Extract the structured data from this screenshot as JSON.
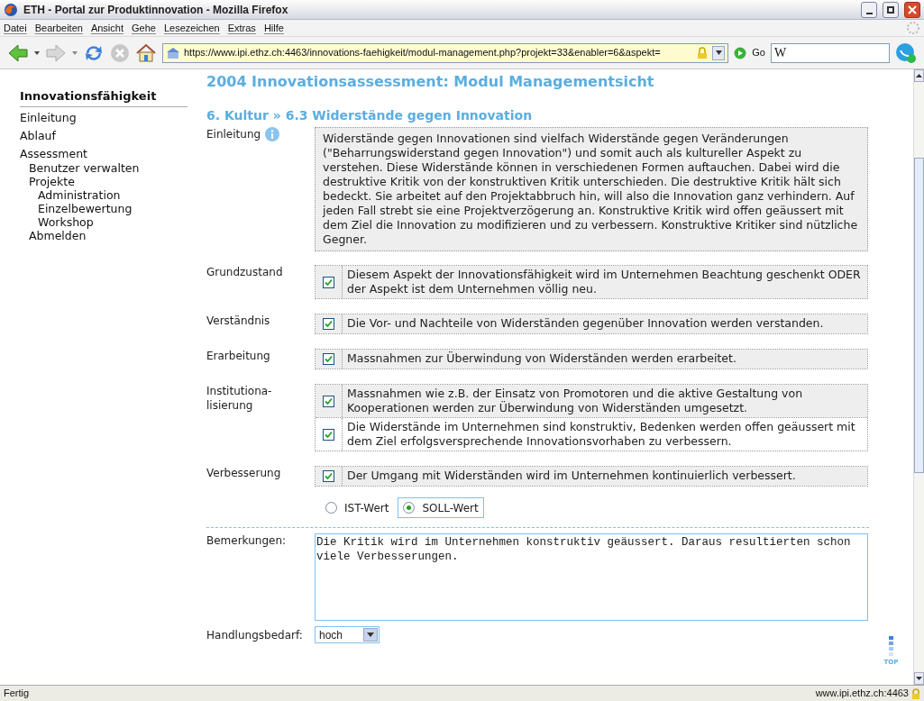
{
  "window": {
    "title": "ETH - Portal zur Produktinnovation - Mozilla Firefox"
  },
  "menu": [
    "Datei",
    "Bearbeiten",
    "Ansicht",
    "Gehe",
    "Lesezeichen",
    "Extras",
    "Hilfe"
  ],
  "toolbar": {
    "address": "https://www.ipi.ethz.ch:4463/innovations-faehigkeit/modul-management.php?projekt=33&enabler=6&aspekt=",
    "go": "Go",
    "search_logo": "W"
  },
  "sidebar": {
    "heading": "Innovationsfähigkeit",
    "items": [
      {
        "label": "Einleitung"
      },
      {
        "label": "Ablauf"
      },
      {
        "label": "Assessment",
        "children": [
          {
            "label": "Benutzer verwalten"
          },
          {
            "label": "Projekte",
            "children": [
              {
                "label": "Administration"
              },
              {
                "label": "Einzelbewertung"
              },
              {
                "label": "Workshop"
              }
            ]
          },
          {
            "label": "Abmelden"
          }
        ]
      }
    ]
  },
  "page": {
    "title": "2004 Innovationsassessment: Modul Managementsicht",
    "breadcrumb": "6. Kultur » 6.3 Widerstände gegen Innovation",
    "intro_label": "Einleitung",
    "intro_text": "Widerstände gegen Innovationen sind vielfach Widerstände gegen Veränderungen (\"Beharrungswiderstand gegen Innovation\") und somit auch als kultureller Aspekt zu verstehen. Diese Widerstände können in verschiedenen Formen auftauchen. Dabei wird die destruktive Kritik von der konstruktiven Kritik unterschieden. Die destruktive Kritik hält sich bedeckt. Sie arbeitet auf den Projektabbruch hin, will also die Innovation ganz verhindern. Auf jeden Fall strebt sie eine Projektverzögerung an. Konstruktive Kritik wird offen geäussert mit dem Ziel die Innovation zu modifizieren und zu verbessern. Konstruktive Kritiker sind nützliche Gegner.",
    "criteria": [
      {
        "label": "Grundzustand",
        "options": [
          {
            "text": "Diesem Aspekt der Innovationsfähigkeit wird im Unternehmen Beachtung geschenkt ODER der Aspekt ist dem Unternehmen völlig neu.",
            "checked": true,
            "shaded": true
          }
        ]
      },
      {
        "label": "Verständnis",
        "options": [
          {
            "text": "Die Vor- und Nachteile von Widerständen gegenüber Innovation werden verstanden.",
            "checked": true,
            "shaded": true
          }
        ]
      },
      {
        "label": "Erarbeitung",
        "options": [
          {
            "text": "Massnahmen zur Überwindung von Widerständen werden erarbeitet.",
            "checked": true,
            "shaded": true
          }
        ]
      },
      {
        "label": "Institutiona-\nlisierung",
        "options": [
          {
            "text": "Massnahmen wie z.B. der Einsatz von Promotoren und die aktive Gestaltung von Kooperationen werden zur Überwindung von Widerständen umgesetzt.",
            "checked": true,
            "shaded": true
          },
          {
            "text": "Die Widerstände im Unternehmen sind konstruktiv, Bedenken werden offen geäussert mit dem Ziel erfolgsversprechende Innovationsvorhaben zu verbessern.",
            "checked": true,
            "shaded": false
          }
        ]
      },
      {
        "label": "Verbesserung",
        "options": [
          {
            "text": "Der Umgang mit Widerständen wird im Unternehmen kontinuierlich verbessert.",
            "checked": true,
            "shaded": true
          }
        ]
      }
    ],
    "value_type": [
      {
        "label": "IST-Wert",
        "selected": false
      },
      {
        "label": "SOLL-Wert",
        "selected": true
      }
    ],
    "remarks_label": "Bemerkungen:",
    "remarks": "Die Kritik wird im Unternehmen konstruktiv geäussert. Daraus resultierten schon viele Verbesserungen.",
    "need_label": "Handlungsbedarf:",
    "need_value": "hoch",
    "top_link": "TOP"
  },
  "status_bar": {
    "text": "Fertig",
    "host": "www.ipi.ethz.ch:4463"
  }
}
